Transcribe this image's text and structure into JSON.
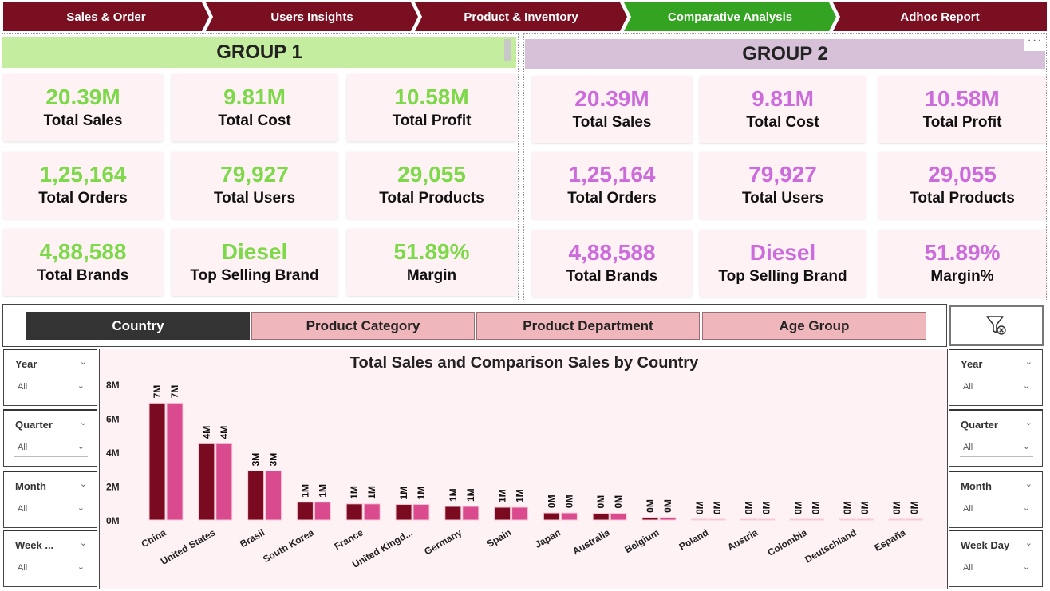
{
  "nav": {
    "tabs": [
      {
        "label": "Sales & Order",
        "active": false
      },
      {
        "label": "Users Insights",
        "active": false
      },
      {
        "label": "Product & Inventory",
        "active": false
      },
      {
        "label": "Comparative Analysis",
        "active": true
      },
      {
        "label": "Adhoc Report",
        "active": false
      }
    ]
  },
  "colors": {
    "nav_inactive": "#7a0f22",
    "nav_active": "#34a321",
    "group1_header": "#c5eda0",
    "group2_header": "#d6c1d8",
    "group1_value": "#7dd84a",
    "group2_value": "#cc6bdb",
    "series_total": "#7a0a1f",
    "series_comparison": "#da4a8f",
    "segment_active": "#333333",
    "segment_inactive": "#efb6bb"
  },
  "group1": {
    "title": "GROUP 1",
    "kpis": [
      {
        "value": "20.39M",
        "label": "Total Sales"
      },
      {
        "value": "9.81M",
        "label": "Total Cost"
      },
      {
        "value": "10.58M",
        "label": "Total Profit"
      },
      {
        "value": "1,25,164",
        "label": "Total Orders"
      },
      {
        "value": "79,927",
        "label": "Total Users"
      },
      {
        "value": "29,055",
        "label": "Total Products"
      },
      {
        "value": "4,88,588",
        "label": "Total Brands"
      },
      {
        "value": "Diesel",
        "label": "Top Selling Brand"
      },
      {
        "value": "51.89%",
        "label": "Margin"
      }
    ]
  },
  "group2": {
    "title": "GROUP 2",
    "more_icon": "ellipsis-icon",
    "kpis": [
      {
        "value": "20.39M",
        "label": "Total Sales"
      },
      {
        "value": "9.81M",
        "label": "Total Cost"
      },
      {
        "value": "10.58M",
        "label": "Total Profit"
      },
      {
        "value": "1,25,164",
        "label": "Total Orders"
      },
      {
        "value": "79,927",
        "label": "Total Users"
      },
      {
        "value": "29,055",
        "label": "Total Products"
      },
      {
        "value": "4,88,588",
        "label": "Total Brands"
      },
      {
        "value": "Diesel",
        "label": "Top Selling Brand"
      },
      {
        "value": "51.89%",
        "label": "Margin%"
      }
    ]
  },
  "segments": [
    {
      "label": "Country",
      "active": true
    },
    {
      "label": "Product Category",
      "active": false
    },
    {
      "label": "Product Department",
      "active": false
    },
    {
      "label": "Age Group",
      "active": false
    }
  ],
  "clear_filters_icon": "funnel-clear-icon",
  "slicers_left": [
    {
      "title": "Year",
      "value": "All"
    },
    {
      "title": "Quarter",
      "value": "All"
    },
    {
      "title": "Month",
      "value": "All"
    },
    {
      "title": "Week ...",
      "value": "All"
    }
  ],
  "slicers_right": [
    {
      "title": "Year",
      "value": "All"
    },
    {
      "title": "Quarter",
      "value": "All"
    },
    {
      "title": "Month",
      "value": "All"
    },
    {
      "title": "Week Day",
      "value": "All"
    }
  ],
  "chart_data": {
    "type": "bar",
    "title": "Total Sales and Comparison Sales by Country",
    "xlabel": "",
    "ylabel": "",
    "ylim": [
      0,
      8
    ],
    "yticks": [
      "0M",
      "2M",
      "4M",
      "6M",
      "8M"
    ],
    "grid": false,
    "categories": [
      "China",
      "United States",
      "Brasil",
      "South Korea",
      "France",
      "United Kingd...",
      "Germany",
      "Spain",
      "Japan",
      "Australia",
      "Belgium",
      "Poland",
      "Austria",
      "Colombia",
      "Deutschland",
      "España"
    ],
    "series": [
      {
        "values": [
          6.9,
          4.5,
          2.9,
          1.05,
          0.95,
          0.92,
          0.8,
          0.75,
          0.42,
          0.4,
          0.15,
          0.03,
          0.02,
          0.02,
          0.01,
          0.01
        ],
        "labels": [
          "7M",
          "4M",
          "3M",
          "1M",
          "1M",
          "1M",
          "1M",
          "1M",
          "0M",
          "0M",
          "0M",
          "0M",
          "0M",
          "0M",
          "0M",
          "0M"
        ]
      },
      {
        "values": [
          6.9,
          4.5,
          2.9,
          1.05,
          0.95,
          0.92,
          0.8,
          0.75,
          0.42,
          0.4,
          0.15,
          0.03,
          0.02,
          0.02,
          0.01,
          0.01
        ],
        "labels": [
          "7M",
          "4M",
          "3M",
          "1M",
          "1M",
          "1M",
          "1M",
          "1M",
          "0M",
          "0M",
          "0M",
          "0M",
          "0M",
          "0M",
          "0M",
          "0M"
        ]
      }
    ]
  }
}
